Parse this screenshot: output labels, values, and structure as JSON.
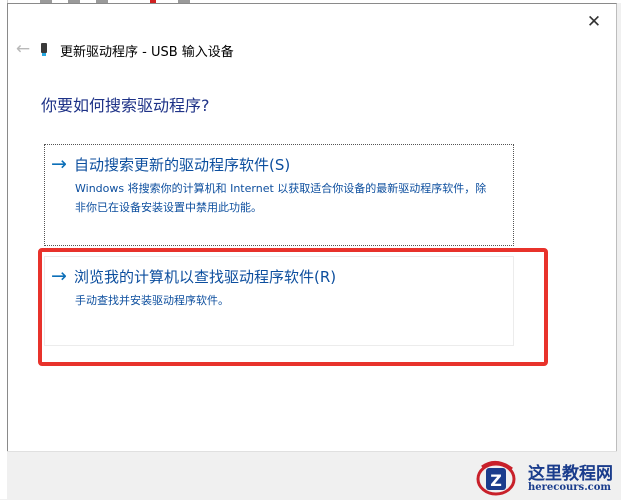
{
  "dialog": {
    "title": "更新驱动程序 - USB 输入设备",
    "close_glyph": "✕",
    "back_glyph": "←",
    "question": "你要如何搜索驱动程序?"
  },
  "options": [
    {
      "arrow": "→",
      "title": "自动搜索更新的驱动程序软件(S)",
      "description": "Windows 将搜索你的计算机和 Internet 以获取适合你设备的最新驱动程序软件，除非你已在设备安装设置中禁用此功能。"
    },
    {
      "arrow": "→",
      "title": "浏览我的计算机以查找驱动程序软件(R)",
      "description": "手动查找并安装驱动程序软件。"
    }
  ],
  "watermark": {
    "brand": "这里教程网",
    "url": "herecours.com",
    "logo_letter": "Z"
  },
  "icons": {
    "back": "back-arrow-icon",
    "close": "close-icon",
    "device": "usb-device-icon",
    "option_arrow": "right-arrow-icon"
  },
  "colors": {
    "accent_link": "#0c4e9e",
    "question_text": "#1e3287",
    "highlight_annotation": "#e8322b"
  }
}
